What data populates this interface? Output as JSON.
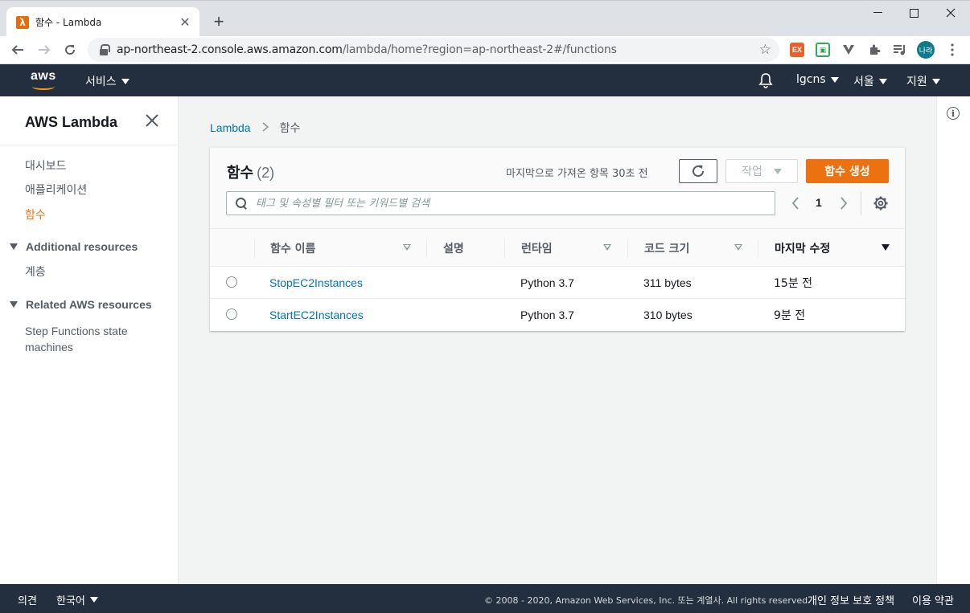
{
  "browser": {
    "tab_title": "함수 - Lambda",
    "tab_favicon": "λ",
    "new_tab": "+",
    "url_host": "ap-northeast-2.console.aws.amazon.com",
    "url_path": "/lambda/home?region=ap-northeast-2#/functions",
    "profile_initials": "나라",
    "ext_labels": [
      "EX",
      "▣"
    ]
  },
  "awsnav": {
    "logo": "aws",
    "services": "서비스",
    "account": "lgcns",
    "region": "서울",
    "support": "지원"
  },
  "sidebar": {
    "title": "AWS Lambda",
    "items": [
      {
        "label": "대시보드"
      },
      {
        "label": "애플리케이션"
      },
      {
        "label": "함수",
        "active": true
      }
    ],
    "sections": [
      {
        "title": "Additional resources",
        "items": [
          {
            "label": "계층"
          }
        ]
      },
      {
        "title": "Related AWS resources",
        "items": [
          {
            "label": "Step Functions state"
          },
          {
            "label": "machines"
          }
        ]
      }
    ]
  },
  "breadcrumb": {
    "root": "Lambda",
    "current": "함수"
  },
  "panel": {
    "title": "함수",
    "count": "(2)",
    "last_fetched": "마지막으로 가져온 항목 30초 전",
    "actions_label": "작업",
    "create_label": "함수 생성",
    "search_placeholder": "태그 및 속성별 필터 또는 키워드별 검색",
    "page": "1"
  },
  "table": {
    "columns": [
      "함수 이름",
      "설명",
      "런타임",
      "코드 크기",
      "마지막 수정"
    ],
    "rows": [
      {
        "name": "StopEC2Instances",
        "description": "",
        "runtime": "Python 3.7",
        "size": "311 bytes",
        "modified": "15분 전"
      },
      {
        "name": "StartEC2Instances",
        "description": "",
        "runtime": "Python 3.7",
        "size": "310 bytes",
        "modified": "9분 전"
      }
    ]
  },
  "footer": {
    "feedback": "의견",
    "language": "한국어",
    "copyright": "© 2008 - 2020, Amazon Web Services, Inc. 또는 계열사. All rights reserved.",
    "privacy": "개인 정보 보호 정책",
    "terms": "이용 약관"
  },
  "colors": {
    "aws_nav": "#232f3e",
    "accent_orange": "#ec7211",
    "link_blue": "#0073bb"
  }
}
